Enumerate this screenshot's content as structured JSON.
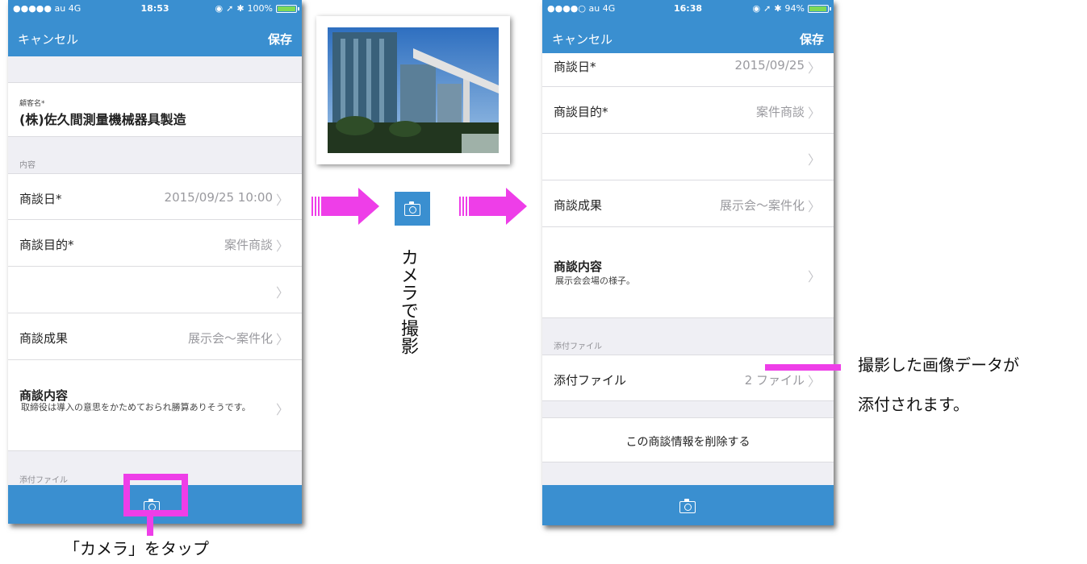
{
  "left_screen": {
    "status": {
      "carrier": "●●●●● au 4G",
      "time": "18:53",
      "battery": "100%",
      "battery_level": 1.0
    },
    "nav": {
      "cancel": "キャンセル",
      "save": "保存"
    },
    "customer": {
      "label": "顧客名*",
      "value": "(株)佐久間測量機械器具製造"
    },
    "section_content": "内容",
    "rows": [
      {
        "label": "商談日*",
        "value": "2015/09/25 10:00"
      },
      {
        "label": "商談目的*",
        "value": "案件商談"
      },
      {
        "label": "",
        "value": ""
      },
      {
        "label": "商談成果",
        "value": "展示会～案件化"
      }
    ],
    "memo": {
      "label": "商談内容",
      "value": "取締役は導入の意思をかためておられ勝算ありそうです。"
    },
    "section_attach": "添付ファイル"
  },
  "right_screen": {
    "status": {
      "carrier": "●●●●○ au 4G",
      "time": "16:38",
      "battery": "94%",
      "battery_level": 0.94
    },
    "nav": {
      "cancel": "キャンセル",
      "save": "保存"
    },
    "rows": [
      {
        "label": "商談日*",
        "value": "2015/09/25"
      },
      {
        "label": "商談目的*",
        "value": "案件商談"
      },
      {
        "label": "",
        "value": ""
      },
      {
        "label": "商談成果",
        "value": "展示会～案件化"
      }
    ],
    "memo": {
      "label": "商談内容",
      "value": "展示会会場の様子。"
    },
    "section_attach": "添付ファイル",
    "attach_row": {
      "label": "添付ファイル",
      "value": "2 ファイル"
    },
    "delete_button": "この商談情報を削除する"
  },
  "annotations": {
    "tap_camera": "「カメラ」をタップ",
    "shoot_with_camera": "カメラで撮影",
    "attached_line1": "撮影した画像データが",
    "attached_line2": "添付されます。"
  },
  "colors": {
    "accent": "#3a8fd0",
    "highlight": "#ee3ee8",
    "chevron": "#c4c4c8",
    "value_gray": "#9a9a9f"
  },
  "icons": {
    "camera": "camera-icon",
    "chevron": "chevron-right-icon",
    "arrow": "arrow-right-icon"
  }
}
